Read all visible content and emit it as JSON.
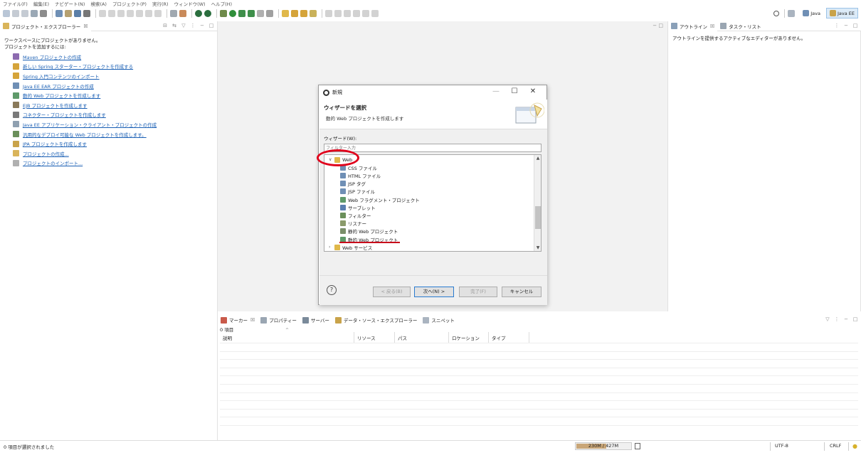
{
  "menu": [
    "ファイル(F)",
    "編集(E)",
    "ナビゲート(N)",
    "検索(A)",
    "プロジェクト(P)",
    "実行(R)",
    "ウィンドウ(W)",
    "ヘルプ(H)"
  ],
  "perspectives": [
    {
      "label": "Java",
      "active": false
    },
    {
      "label": "Java EE",
      "active": true
    }
  ],
  "project_explorer": {
    "tab_label": "プロジェクト・エクスプローラー",
    "tab_close": "☒",
    "no_projects_line1": "ワークスペースにプロジェクトがありません。",
    "no_projects_line2": "プロジェクトを追加するには:",
    "links": [
      "Maven プロジェクトの作成",
      "新しい Spring スターター・プロジェクトを作成する",
      "Spring 入門コンテンツのインポート",
      "Java EE EAR プロジェクトの作成",
      "動的 Web プロジェクトを作成します",
      "EJB プロジェクトを作成します",
      "コネクター・プロジェクトを作成します",
      "Java EE アプリケーション・クライアント・プロジェクトの作成",
      "汎用的なデプロイ可能な Web プロジェクトを作成します。",
      "JPA プロジェクトを作成します",
      "プロジェクトの作成...",
      "プロジェクトのインポート..."
    ]
  },
  "outline": {
    "tabs": [
      {
        "label": "アウトライン",
        "close": "☒"
      },
      {
        "label": "タスク・リスト",
        "close": ""
      }
    ],
    "message": "アウトラインを提供するアクティブなエディターがありません。"
  },
  "dialog": {
    "title": "新規",
    "window_buttons": [
      "—",
      "☐",
      "✕"
    ],
    "header_title": "ウィザードを選択",
    "header_desc": "動的 Web プロジェクトを作成します",
    "wizard_label": "ウィザード(W):",
    "filter_placeholder": "フィルター入力",
    "tree": [
      {
        "label": "Web",
        "indent": 0,
        "expanded": true,
        "folder": true
      },
      {
        "label": "CSS ファイル",
        "indent": 1
      },
      {
        "label": "HTML ファイル",
        "indent": 1
      },
      {
        "label": "JSP タグ",
        "indent": 1
      },
      {
        "label": "JSP ファイル",
        "indent": 1
      },
      {
        "label": "Web フラグメント・プロジェクト",
        "indent": 1
      },
      {
        "label": "サーブレット",
        "indent": 1
      },
      {
        "label": "フィルター",
        "indent": 1
      },
      {
        "label": "リスナー",
        "indent": 1
      },
      {
        "label": "静的 Web プロジェクト",
        "indent": 1
      },
      {
        "label": "動的 Web プロジェクト",
        "indent": 1,
        "selected": true
      },
      {
        "label": "Web サービス",
        "indent": 0,
        "expanded": false,
        "folder": true
      }
    ],
    "buttons": {
      "help": "?",
      "back": "< 戻る(B)",
      "next": "次へ(N) >",
      "finish": "完了(F)",
      "cancel": "キャンセル"
    }
  },
  "markers": {
    "tabs": [
      {
        "label": "マーカー",
        "close": "☒"
      },
      {
        "label": "プロパティー"
      },
      {
        "label": "サーバー"
      },
      {
        "label": "データ・ソース・エクスプローラー"
      },
      {
        "label": "スニペット"
      }
    ],
    "count": "0 項目",
    "columns": [
      "説明",
      "リソース",
      "パス",
      "ロケーション",
      "タイプ"
    ]
  },
  "status": {
    "selection": "0 項目が選択されました",
    "heap": "230M / 427M",
    "heap_used_fraction": 0.54,
    "encoding": "UTF-8",
    "line_ending": "CRLF"
  },
  "colors": {
    "annotation_red": "#e0001b",
    "link_blue": "#1a5fb4",
    "perspective_active": "#dcebf8"
  }
}
